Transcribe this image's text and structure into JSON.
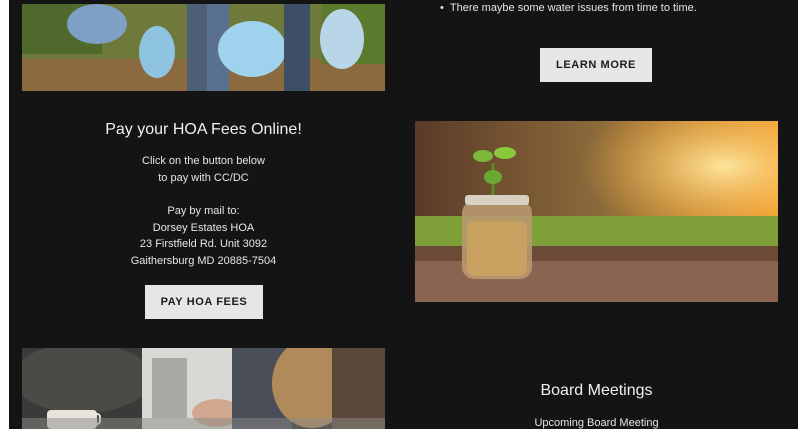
{
  "bullet": {
    "marker": "•",
    "text": "There maybe some water issues from time to time."
  },
  "learn_more": {
    "label": "LEARN MORE"
  },
  "hoa": {
    "title": "Pay your HOA Fees Online!",
    "instruction_line1": "Click on the button below",
    "instruction_line2": "to pay with CC/DC",
    "mail_heading": "Pay by mail to:",
    "mail_name": "Dorsey Estates HOA",
    "mail_street": "23 Firstfield Rd. Unit 3092",
    "mail_city": "Gaithersburg  MD 20885-7504",
    "pay_button": "PAY HOA FEES"
  },
  "board": {
    "title": "Board Meetings",
    "upcoming": "Upcoming Board Meeting"
  },
  "colors": {
    "page_bg": "#141414",
    "button_bg": "#e6e6e6",
    "text": "#e6e6e6"
  }
}
